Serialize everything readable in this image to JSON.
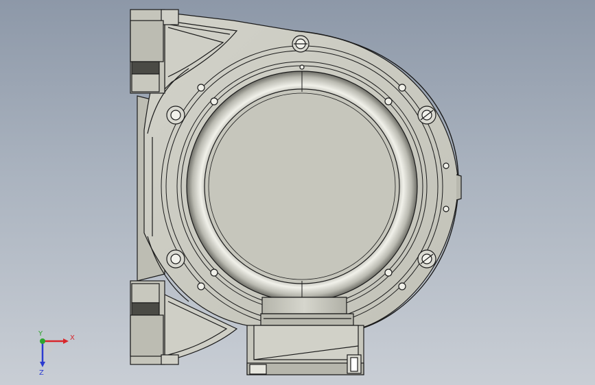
{
  "triad": {
    "x_label": "X",
    "y_label": "Y",
    "z_label": "Z",
    "x_color": "#d8262b",
    "y_color": "#2ea52e",
    "z_color": "#2b3bd0"
  },
  "colors": {
    "metal": "#c9c9bf",
    "metal_light": "#e3e3da",
    "metal_dark": "#8f8f86",
    "edge": "#1a1a1a"
  }
}
